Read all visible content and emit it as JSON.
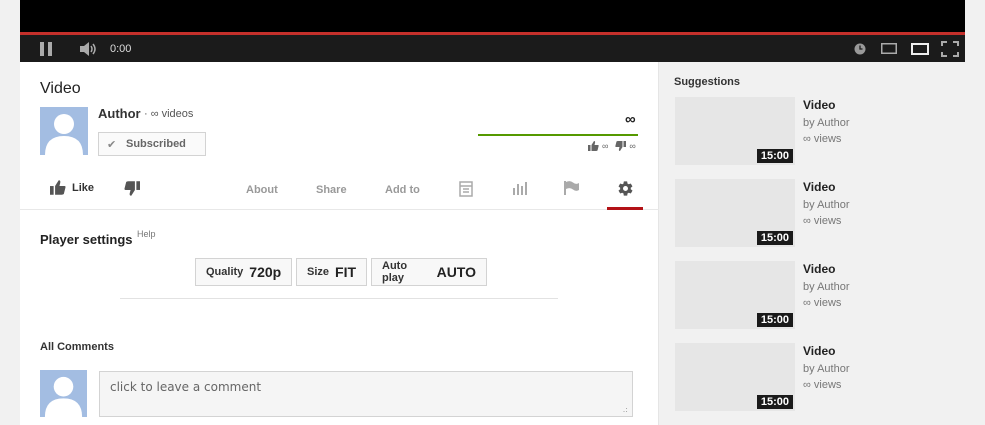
{
  "player": {
    "time": "0:00"
  },
  "video": {
    "title": "Video",
    "author": "Author",
    "video_count": "· ∞ videos",
    "subscribe_label": "Subscribed",
    "view_count": "∞",
    "likes": "∞",
    "dislikes": "∞"
  },
  "actions": {
    "like_label": "Like",
    "tabs": [
      {
        "label": "About"
      },
      {
        "label": "Share"
      },
      {
        "label": "Add to"
      }
    ]
  },
  "settings": {
    "title": "Player settings",
    "help": "Help",
    "quality": {
      "label": "Quality",
      "value": "720p"
    },
    "size": {
      "label": "Size",
      "value": "FIT"
    },
    "autoplay": {
      "label": "Auto play",
      "value": "AUTO"
    }
  },
  "comments": {
    "title": "All Comments",
    "placeholder": "click to leave a comment"
  },
  "suggestions": {
    "title": "Suggestions",
    "items": [
      {
        "title": "Video",
        "author": "by Author",
        "views": "∞ views",
        "duration": "15:00"
      },
      {
        "title": "Video",
        "author": "by Author",
        "views": "∞ views",
        "duration": "15:00"
      },
      {
        "title": "Video",
        "author": "by Author",
        "views": "∞ views",
        "duration": "15:00"
      },
      {
        "title": "Video",
        "author": "by Author",
        "views": "∞ views",
        "duration": "15:00"
      }
    ]
  },
  "colors": {
    "progress": "#c4302b",
    "like_bar": "#559900",
    "gear_tab_underline": "#b31217",
    "avatar": "#a3bde2"
  }
}
